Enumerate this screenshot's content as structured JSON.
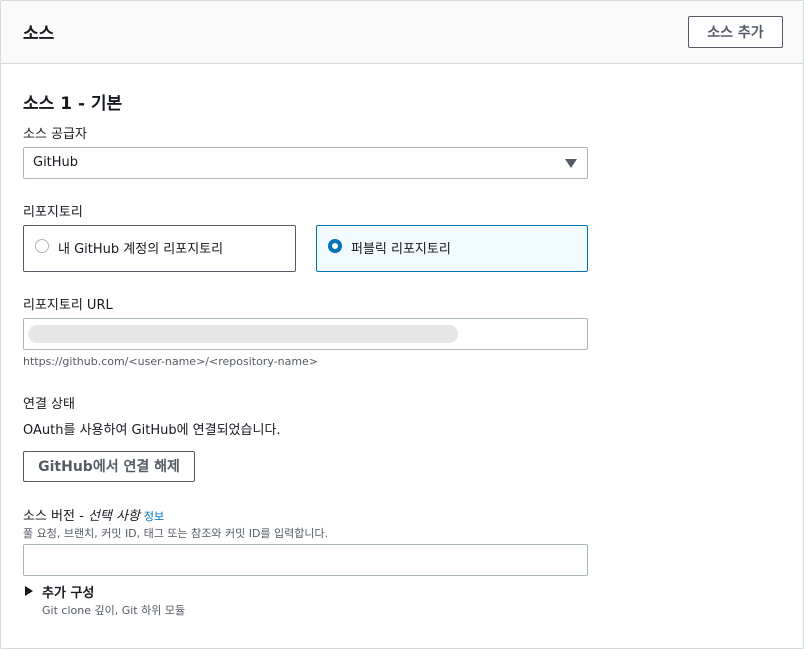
{
  "header": {
    "title": "소스",
    "add_button": "소스 추가"
  },
  "source": {
    "title": "소스 1 - 기본",
    "provider": {
      "label": "소스 공급자",
      "value": "GitHub"
    },
    "repository": {
      "label": "리포지토리",
      "options": [
        {
          "label": "내 GitHub 계정의 리포지토리",
          "selected": false
        },
        {
          "label": "퍼블릭 리포지토리",
          "selected": true
        }
      ]
    },
    "url": {
      "label": "리포지토리 URL",
      "hint": "https://github.com/<user-name>/<repository-name>"
    },
    "connection": {
      "label": "연결 상태",
      "status": "OAuth를 사용하여 GitHub에 연결되었습니다.",
      "disconnect_button": "GitHub에서 연결 해제"
    },
    "version": {
      "label": "소스 버전 - ",
      "optional": "선택 사항",
      "info": "정보",
      "hint": "풀 요청, 브랜치, 커밋 ID, 태그 또는 참조와 커밋 ID를 입력합니다."
    },
    "additional": {
      "label": "추가 구성",
      "sub": "Git clone 깊이, Git 하위 모듈"
    }
  },
  "colors": {
    "accent": "#0073bb",
    "border": "#aab7b8",
    "header_bg": "#fafafa"
  }
}
